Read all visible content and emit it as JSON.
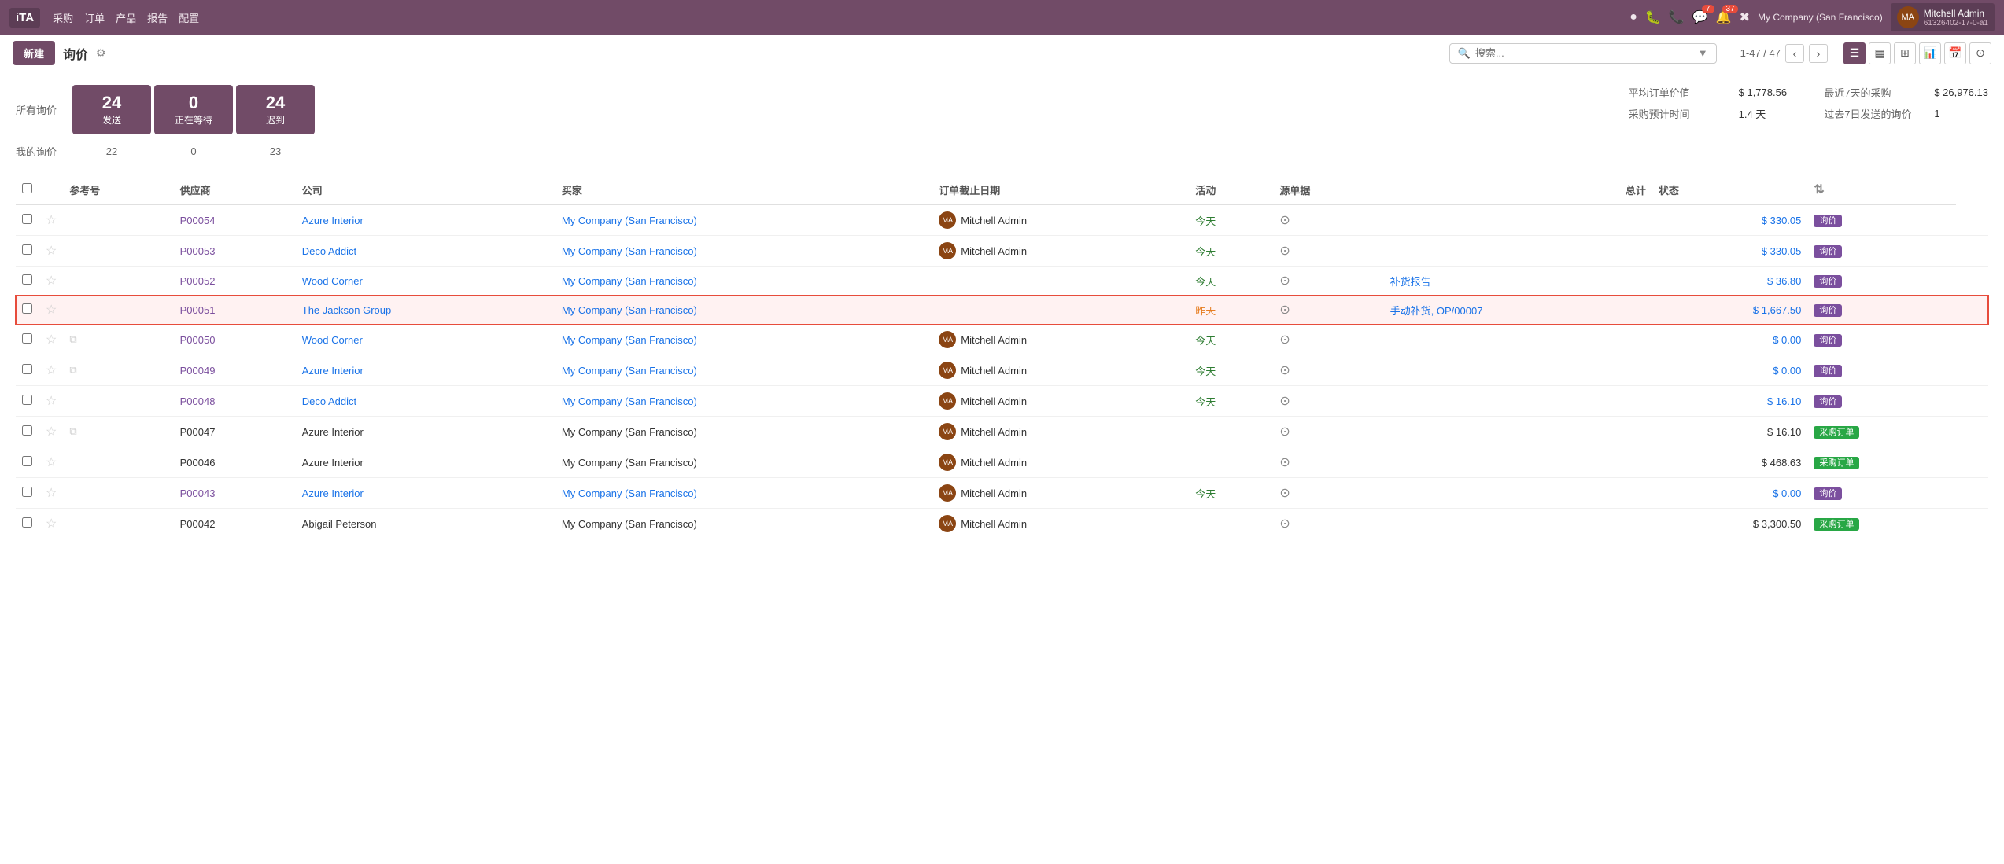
{
  "topnav": {
    "logo": "iTA",
    "menu": [
      "采购",
      "订单",
      "产品",
      "报告",
      "配置"
    ],
    "icons": [
      "●",
      "🐛",
      "📞",
      "💬",
      "🔔",
      "✖"
    ],
    "badge_chat": "7",
    "badge_notif": "37",
    "company": "My Company (San Francisco)",
    "user_name": "Mitchell Admin",
    "user_id": "61326402-17-0-a1"
  },
  "secondarybar": {
    "new_btn": "新建",
    "title": "询价",
    "search_placeholder": "搜索...",
    "pagination": "1-47 / 47",
    "view_icons": [
      "☰",
      "▦",
      "⊞",
      "📊",
      "📅",
      "⊙"
    ]
  },
  "stats": {
    "all_label": "所有询价",
    "my_label": "我的询价",
    "cards": [
      {
        "num": "24",
        "label": "发送"
      },
      {
        "num": "0",
        "label": "正在等待"
      },
      {
        "num": "24",
        "label": "迟到"
      }
    ],
    "my_vals": [
      "22",
      "0",
      "23"
    ],
    "right": [
      {
        "key": "平均订单价值",
        "val": "$ 1,778.56"
      },
      {
        "key": "最近7天的采购",
        "val": "$ 26,976.13"
      },
      {
        "key": "采购预计时间",
        "val": "1.4 天"
      },
      {
        "key": "过去7日发送的询价",
        "val": "1"
      }
    ]
  },
  "table": {
    "columns": [
      "参考号",
      "供应商",
      "公司",
      "买家",
      "订单截止日期",
      "活动",
      "源单据",
      "总计",
      "状态"
    ],
    "rows": [
      {
        "ref": "P00054",
        "supplier": "Azure Interior",
        "company": "My Company (San Francisco)",
        "buyer": "Mitchell Admin",
        "date": "今天",
        "activity": "⊙",
        "source": "",
        "amount": "$ 330.05",
        "status": "询价",
        "status_type": "xunjia",
        "highlighted": false,
        "starred": false,
        "has_copy": false,
        "ref_link": true,
        "supplier_link": true,
        "company_link": true,
        "date_color": "today"
      },
      {
        "ref": "P00053",
        "supplier": "Deco Addict",
        "company": "My Company (San Francisco)",
        "buyer": "Mitchell Admin",
        "date": "今天",
        "activity": "⊙",
        "source": "",
        "amount": "$ 330.05",
        "status": "询价",
        "status_type": "xunjia",
        "highlighted": false,
        "starred": false,
        "has_copy": false,
        "ref_link": true,
        "supplier_link": true,
        "company_link": true,
        "date_color": "today"
      },
      {
        "ref": "P00052",
        "supplier": "Wood Corner",
        "company": "My Company (San Francisco)",
        "buyer": "",
        "date": "今天",
        "activity": "⊙",
        "source": "补货报告",
        "amount": "$ 36.80",
        "status": "询价",
        "status_type": "xunjia",
        "highlighted": false,
        "starred": false,
        "has_copy": false,
        "ref_link": true,
        "supplier_link": true,
        "company_link": true,
        "date_color": "today"
      },
      {
        "ref": "P00051",
        "supplier": "The Jackson Group",
        "company": "My Company (San Francisco)",
        "buyer": "",
        "date": "昨天",
        "activity": "⊙",
        "source": "手动补货, OP/00007",
        "amount": "$ 1,667.50",
        "status": "询价",
        "status_type": "xunjia",
        "highlighted": true,
        "starred": false,
        "has_copy": false,
        "ref_link": true,
        "supplier_link": true,
        "company_link": true,
        "date_color": "yesterday"
      },
      {
        "ref": "P00050",
        "supplier": "Wood Corner",
        "company": "My Company (San Francisco)",
        "buyer": "Mitchell Admin",
        "date": "今天",
        "activity": "⊙",
        "source": "",
        "amount": "$ 0.00",
        "status": "询价",
        "status_type": "xunjia",
        "highlighted": false,
        "starred": false,
        "has_copy": true,
        "ref_link": true,
        "supplier_link": true,
        "company_link": true,
        "date_color": "today"
      },
      {
        "ref": "P00049",
        "supplier": "Azure Interior",
        "company": "My Company (San Francisco)",
        "buyer": "Mitchell Admin",
        "date": "今天",
        "activity": "⊙",
        "source": "",
        "amount": "$ 0.00",
        "status": "询价",
        "status_type": "xunjia",
        "highlighted": false,
        "starred": false,
        "has_copy": true,
        "ref_link": true,
        "supplier_link": true,
        "company_link": true,
        "date_color": "today"
      },
      {
        "ref": "P00048",
        "supplier": "Deco Addict",
        "company": "My Company (San Francisco)",
        "buyer": "Mitchell Admin",
        "date": "今天",
        "activity": "⊙",
        "source": "",
        "amount": "$ 16.10",
        "status": "询价",
        "status_type": "xunjia",
        "highlighted": false,
        "starred": false,
        "has_copy": false,
        "ref_link": true,
        "supplier_link": true,
        "company_link": true,
        "date_color": "today"
      },
      {
        "ref": "P00047",
        "supplier": "Azure Interior",
        "company": "My Company (San Francisco)",
        "buyer": "Mitchell Admin",
        "date": "",
        "activity": "⊙",
        "source": "",
        "amount": "$ 16.10",
        "status": "采购订单",
        "status_type": "caigou",
        "highlighted": false,
        "starred": false,
        "has_copy": true,
        "ref_link": false,
        "supplier_link": false,
        "company_link": false,
        "date_color": ""
      },
      {
        "ref": "P00046",
        "supplier": "Azure Interior",
        "company": "My Company (San Francisco)",
        "buyer": "Mitchell Admin",
        "date": "",
        "activity": "⊙",
        "source": "",
        "amount": "$ 468.63",
        "status": "采购订单",
        "status_type": "caigou",
        "highlighted": false,
        "starred": false,
        "has_copy": false,
        "ref_link": false,
        "supplier_link": false,
        "company_link": false,
        "date_color": ""
      },
      {
        "ref": "P00043",
        "supplier": "Azure Interior",
        "company": "My Company (San Francisco)",
        "buyer": "Mitchell Admin",
        "date": "今天",
        "activity": "⊙",
        "source": "",
        "amount": "$ 0.00",
        "status": "询价",
        "status_type": "xunjia",
        "highlighted": false,
        "starred": false,
        "has_copy": false,
        "ref_link": true,
        "supplier_link": true,
        "company_link": true,
        "date_color": "today"
      },
      {
        "ref": "P00042",
        "supplier": "Abigail Peterson",
        "company": "My Company (San Francisco)",
        "buyer": "Mitchell Admin",
        "date": "",
        "activity": "⊙",
        "source": "",
        "amount": "$ 3,300.50",
        "status": "采购订单",
        "status_type": "caigou",
        "highlighted": false,
        "starred": false,
        "has_copy": false,
        "ref_link": false,
        "supplier_link": false,
        "company_link": false,
        "date_color": ""
      }
    ]
  }
}
